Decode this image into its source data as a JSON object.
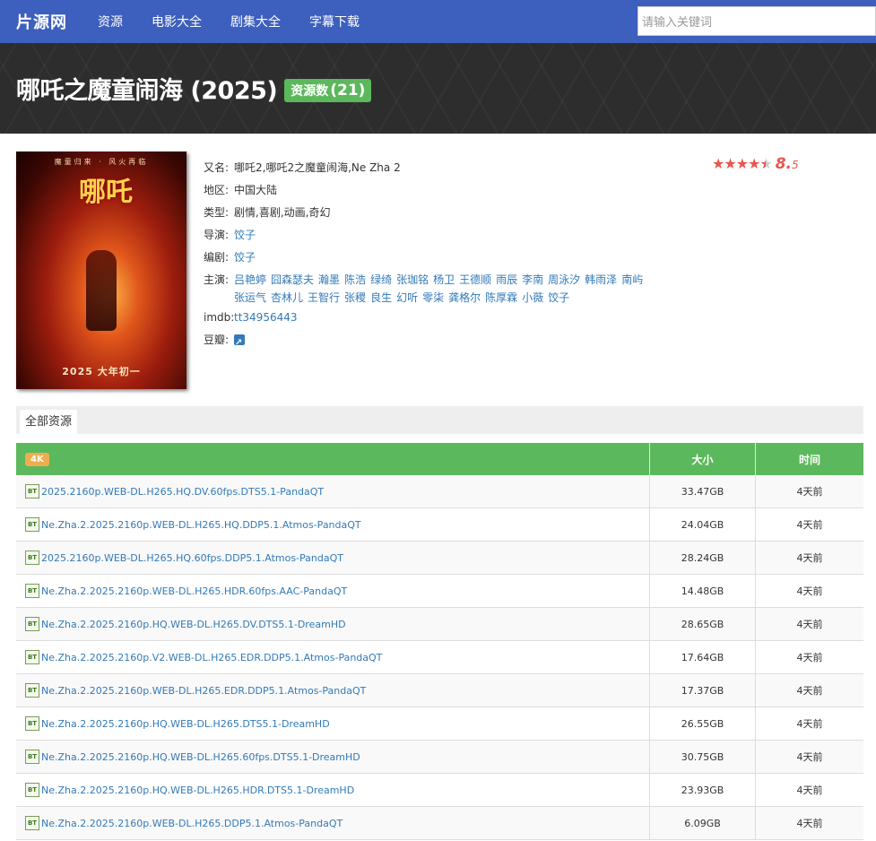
{
  "nav": {
    "brand": "片源网",
    "items": [
      "资源",
      "电影大全",
      "剧集大全",
      "字幕下载"
    ],
    "search_placeholder": "请输入关键词"
  },
  "movie": {
    "title": "哪吒之魔童闹海 (2025)",
    "resource_label": "资源数",
    "resource_count": "(21)",
    "alias_label": "又名:",
    "alias": "哪吒2,哪吒2之魔童闹海,Ne Zha 2",
    "region_label": "地区:",
    "region": "中国大陆",
    "genre_label": "类型:",
    "genre": "剧情,喜剧,动画,奇幻",
    "director_label": "导演:",
    "director": "饺子",
    "writer_label": "编剧:",
    "writer": "饺子",
    "cast_label": "主演:",
    "cast": [
      "吕艳婷",
      "囧森瑟夫",
      "瀚墨",
      "陈浩",
      "绿绮",
      "张珈铭",
      "杨卫",
      "王德顺",
      "雨辰",
      "李南",
      "周泳汐",
      "韩雨泽",
      "南屿",
      "张运气",
      "杏林儿",
      "王智行",
      "张稷",
      "良生",
      "幻听",
      "零柒",
      "龚格尔",
      "陈厚霖",
      "小薇",
      "饺子"
    ],
    "imdb_label": "imdb:",
    "imdb": "tt34956443",
    "douban_label": "豆瓣:",
    "rating_int": "8.",
    "rating_dec": "5",
    "rating_value": 8.5,
    "poster_top": "魔童归来 · 风火再临",
    "poster_logo": "哪吒",
    "poster_bottom": "2025 大年初一"
  },
  "tabs": {
    "all": "全部资源"
  },
  "table": {
    "tag": "4K",
    "col_size": "大小",
    "col_time": "时间",
    "rows": [
      {
        "name": "2025.2160p.WEB-DL.H265.HQ.DV.60fps.DTS5.1-PandaQT",
        "size": "33.47GB",
        "time": "4天前"
      },
      {
        "name": "Ne.Zha.2.2025.2160p.WEB-DL.H265.HQ.DDP5.1.Atmos-PandaQT",
        "size": "24.04GB",
        "time": "4天前"
      },
      {
        "name": "2025.2160p.WEB-DL.H265.HQ.60fps.DDP5.1.Atmos-PandaQT",
        "size": "28.24GB",
        "time": "4天前"
      },
      {
        "name": "Ne.Zha.2.2025.2160p.WEB-DL.H265.HDR.60fps.AAC-PandaQT",
        "size": "14.48GB",
        "time": "4天前"
      },
      {
        "name": "Ne.Zha.2.2025.2160p.HQ.WEB-DL.H265.DV.DTS5.1-DreamHD",
        "size": "28.65GB",
        "time": "4天前"
      },
      {
        "name": "Ne.Zha.2.2025.2160p.V2.WEB-DL.H265.EDR.DDP5.1.Atmos-PandaQT",
        "size": "17.64GB",
        "time": "4天前"
      },
      {
        "name": "Ne.Zha.2.2025.2160p.WEB-DL.H265.EDR.DDP5.1.Atmos-PandaQT",
        "size": "17.37GB",
        "time": "4天前"
      },
      {
        "name": "Ne.Zha.2.2025.2160p.HQ.WEB-DL.H265.DTS5.1-DreamHD",
        "size": "26.55GB",
        "time": "4天前"
      },
      {
        "name": "Ne.Zha.2.2025.2160p.HQ.WEB-DL.H265.60fps.DTS5.1-DreamHD",
        "size": "30.75GB",
        "time": "4天前"
      },
      {
        "name": "Ne.Zha.2.2025.2160p.HQ.WEB-DL.H265.HDR.DTS5.1-DreamHD",
        "size": "23.93GB",
        "time": "4天前"
      },
      {
        "name": "Ne.Zha.2.2025.2160p.WEB-DL.H265.DDP5.1.Atmos-PandaQT",
        "size": "6.09GB",
        "time": "4天前"
      }
    ]
  },
  "colors": {
    "nav": "#3d5fbe",
    "green": "#5cb85c",
    "link": "#337ab7",
    "star": "#e8574d",
    "tag": "#f0ad4e"
  }
}
